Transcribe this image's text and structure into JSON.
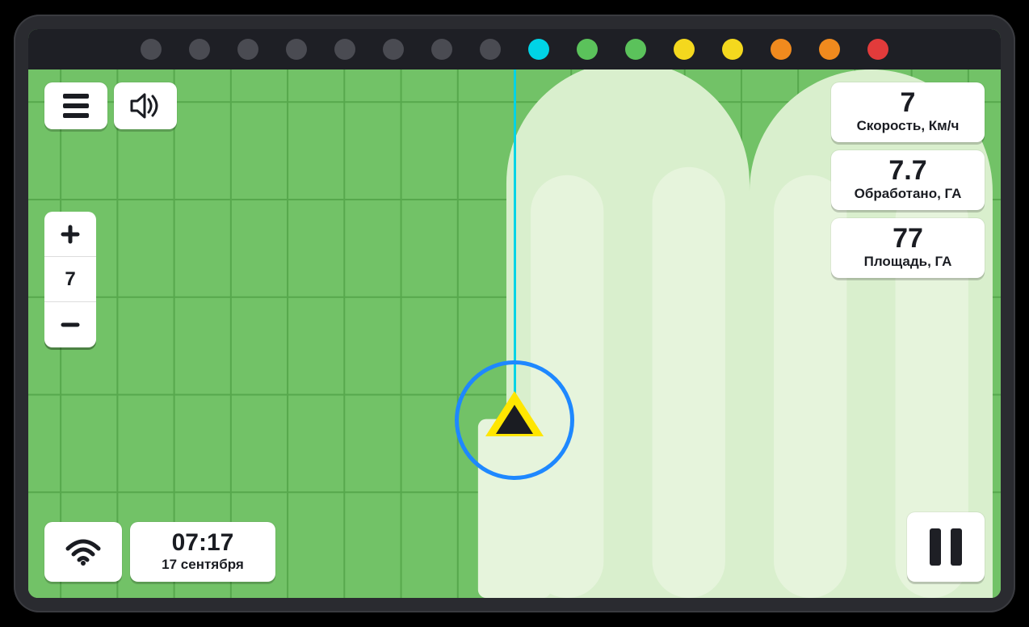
{
  "leds": [
    "#4a4b52",
    "#4a4b52",
    "#4a4b52",
    "#4a4b52",
    "#4a4b52",
    "#4a4b52",
    "#4a4b52",
    "#4a4b52",
    "#00d3e6",
    "#5bc25b",
    "#5bc25b",
    "#f4d81e",
    "#f4d81e",
    "#f08a1e",
    "#f08a1e",
    "#e23b3b"
  ],
  "zoom": {
    "level": "7"
  },
  "clock": {
    "time": "07:17",
    "date": "17 сентября"
  },
  "stats": {
    "speed": {
      "value": "7",
      "label": "Скорость, Км/ч"
    },
    "worked": {
      "value": "7.7",
      "label": "Обработано, ГА"
    },
    "area": {
      "value": "77",
      "label": "Площадь, ГА"
    }
  }
}
